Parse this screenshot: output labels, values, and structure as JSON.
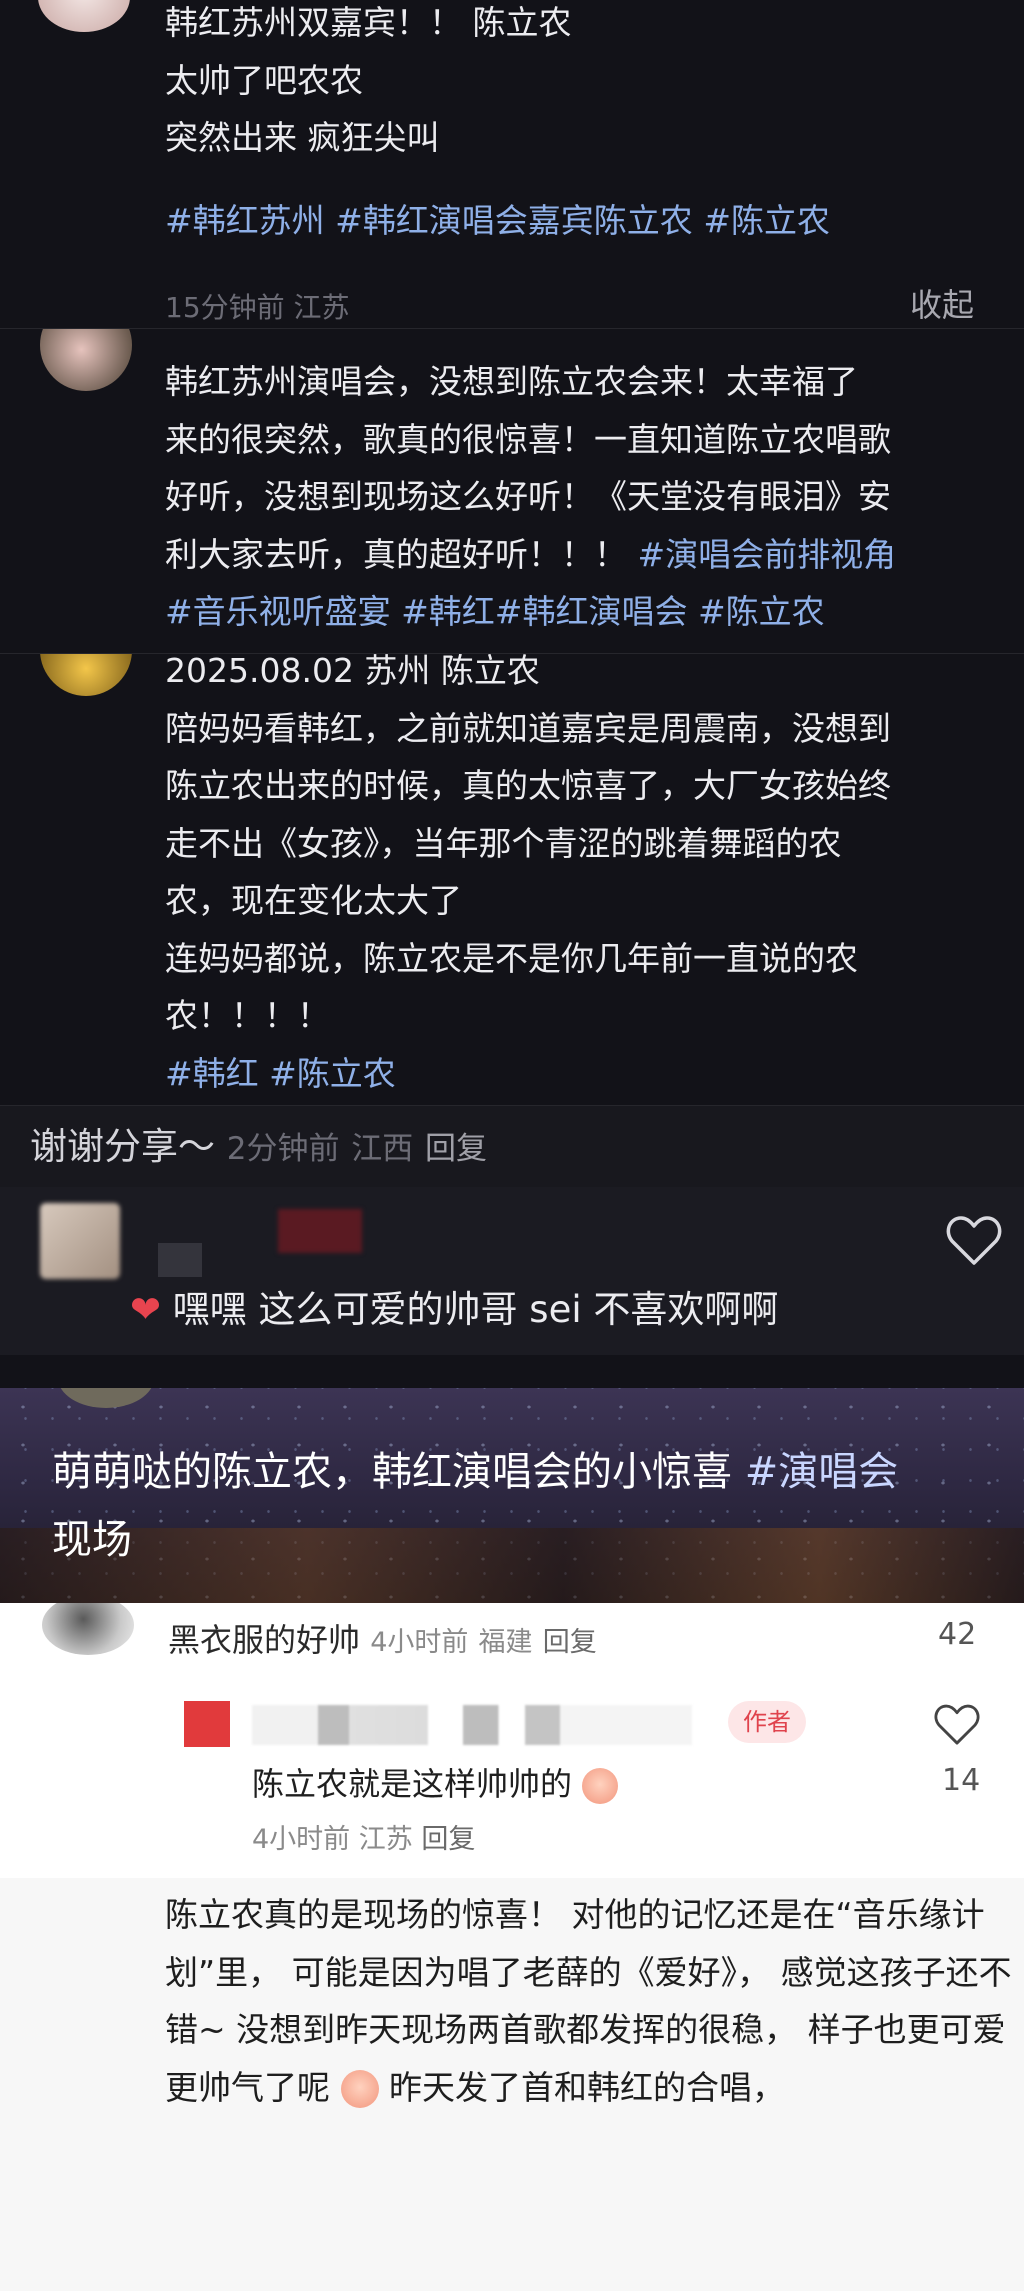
{
  "post1": {
    "lines": [
      "韩红苏州双嘉宾！！ 陈立农",
      "太帅了吧农农",
      "突然出来 疯狂尖叫"
    ],
    "tags": [
      "#韩红苏州",
      "#韩红演唱会嘉宾陈立农",
      "#陈立农"
    ],
    "time": "15分钟前",
    "location": "江苏",
    "collapse": "收起"
  },
  "post2": {
    "line1": "韩红苏州演唱会，没想到陈立农会来！太幸福了",
    "line2": "来的很突然，歌真的很惊喜！一直知道陈立农唱歌",
    "line3": "好听，没想到现场这么好听！《天堂没有眼泪》安",
    "line4_text": "利大家去听，真的超好听！！！",
    "line4_tag": "#演唱会前排视角",
    "tags_line5": [
      "#音乐视听盛宴",
      "#韩红#韩红演唱会",
      "#陈立农"
    ]
  },
  "post3": {
    "lines": [
      "2025.08.02 苏州 陈立农",
      "陪妈妈看韩红，之前就知道嘉宾是周震南，没想到",
      "陈立农出来的时候，真的太惊喜了，大厂女孩始终",
      "走不出《女孩》，当年那个青涩的跳着舞蹈的农",
      "农，现在变化太大了",
      "连妈妈都说，陈立农是不是你几年前一直说的农",
      "农！！！！"
    ],
    "tags": [
      "#韩红",
      "#陈立农"
    ]
  },
  "reply1": {
    "text": "谢谢分享～",
    "time": "2分钟前",
    "location": "江西",
    "reply": "回复"
  },
  "comment_dark": {
    "emoji": "❤️",
    "text": "嘿嘿 这么可爱的帅哥 sei 不喜欢啊啊"
  },
  "video_caption": {
    "line1_text": "萌萌哒的陈立农，韩红演唱会的小惊喜",
    "line1_tag": "#演唱会",
    "line2": "现场"
  },
  "comment_light": {
    "user": "黑衣服的好帅",
    "time": "4小时前",
    "location": "福建",
    "reply": "回复",
    "likes": "42",
    "author_badge": "作者",
    "sub_text": "陈立农就是这样帅帅的",
    "sub_time": "4小时前",
    "sub_location": "江苏",
    "sub_reply": "回复",
    "sub_likes": "14"
  },
  "post4": {
    "lines": [
      "陈立农真的是现场的惊喜！",
      "对他的记忆还是在“音乐缘计划”里，",
      "可能是因为唱了老薛的《爱好》，",
      "感觉这孩子还不错~",
      "没想到昨天现场两首歌都发挥的很稳，",
      "样子也更可爱更帅气了呢",
      "昨天发了首和韩红的合唱，"
    ]
  }
}
